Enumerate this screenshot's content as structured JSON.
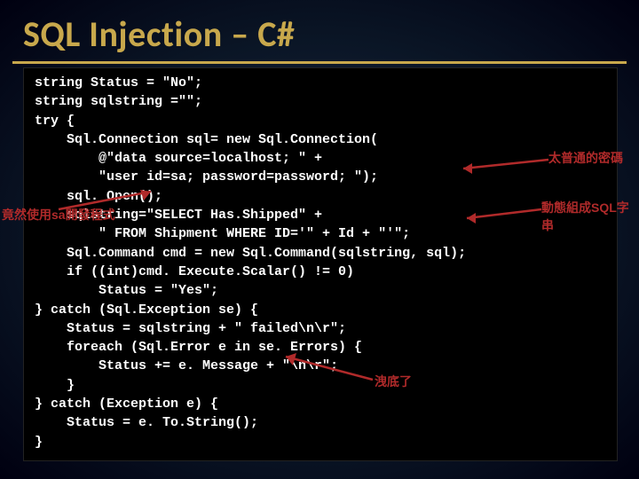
{
  "title": "SQL Injection – C#",
  "code": "string Status = \"No\";\nstring sqlstring =\"\";\ntry {\n    Sql.Connection sql= new Sql.Connection(\n        @\"data source=localhost; \" +\n        \"user id=sa; password=password; \");\n    sql. Open();\n    sqlstring=\"SELECT Has.Shipped\" +\n        \" FROM Shipment WHERE ID='\" + Id + \"'\";\n    Sql.Command cmd = new Sql.Command(sqlstring, sql);\n    if ((int)cmd. Execute.Scalar() != 0)\n        Status = \"Yes\";\n} catch (Sql.Exception se) {\n    Status = sqlstring + \" failed\\n\\r\";\n    foreach (Sql.Error e in se. Errors) {\n        Status += e. Message + \"\\n\\r\";\n    }\n} catch (Exception e) {\n    Status = e. To.String();\n}",
  "annotations": {
    "too_common_password": "太普通的密碼",
    "dynamic_sql": "動態組成SQL字串",
    "sa_dev": "竟然使用sa開發程式",
    "leaked": "洩底了"
  }
}
